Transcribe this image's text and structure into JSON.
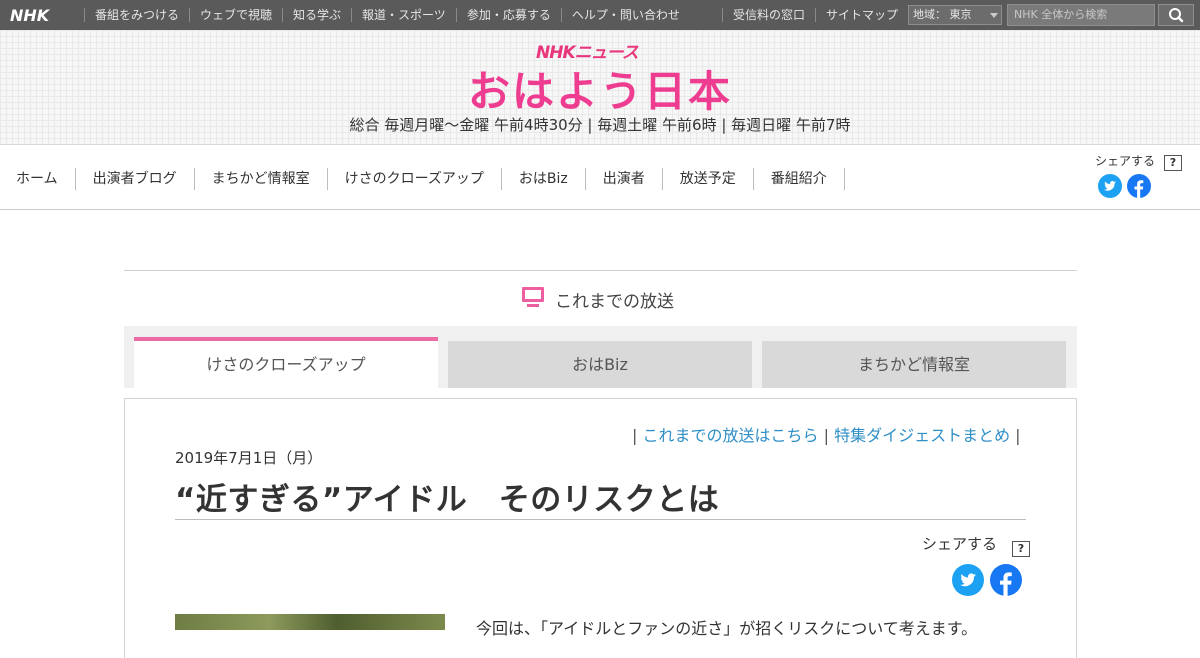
{
  "topbar": {
    "logo": "NHK",
    "nav": [
      "番組をみつける",
      "ウェブで視聴",
      "知る学ぶ",
      "報道・スポーツ",
      "参加・応募する",
      "ヘルプ・問い合わせ"
    ],
    "right_links": [
      "受信料の窓口",
      "サイトマップ"
    ],
    "region_label": "地域： 東京",
    "search_placeholder": "NHK 全体から検索"
  },
  "header": {
    "brand": "NHKニュース",
    "title": "おはよう日本",
    "schedule": "総合 毎週月曜～金曜 午前4時30分 | 毎週土曜 午前6時 | 毎週日曜 午前7時"
  },
  "gnav": {
    "items": [
      "ホーム",
      "出演者ブログ",
      "まちかど情報室",
      "けさのクローズアップ",
      "おはBiz",
      "出演者",
      "放送予定",
      "番組紹介"
    ],
    "share_label": "シェアする",
    "help": "?"
  },
  "section": {
    "title": "これまでの放送"
  },
  "tabs": [
    {
      "label": "けさのクローズアップ",
      "active": true
    },
    {
      "label": "おはBiz",
      "active": false
    },
    {
      "label": "まちかど情報室",
      "active": false
    }
  ],
  "article": {
    "link1": "これまでの放送はこちら",
    "link2": "特集ダイジェストまとめ",
    "date": "2019年7月1日（月）",
    "headline": "“近すぎる”アイドル　そのリスクとは",
    "share_label": "シェアする",
    "help": "?",
    "lead": "今回は、「アイドルとファンの近さ」が招くリスクについて考えます。"
  },
  "colors": {
    "accent_pink": "#ee3d91",
    "tab_active_border": "#ee6aa7",
    "link_blue": "#2f8fc7",
    "twitter": "#1da1f2",
    "facebook": "#1877f2"
  }
}
